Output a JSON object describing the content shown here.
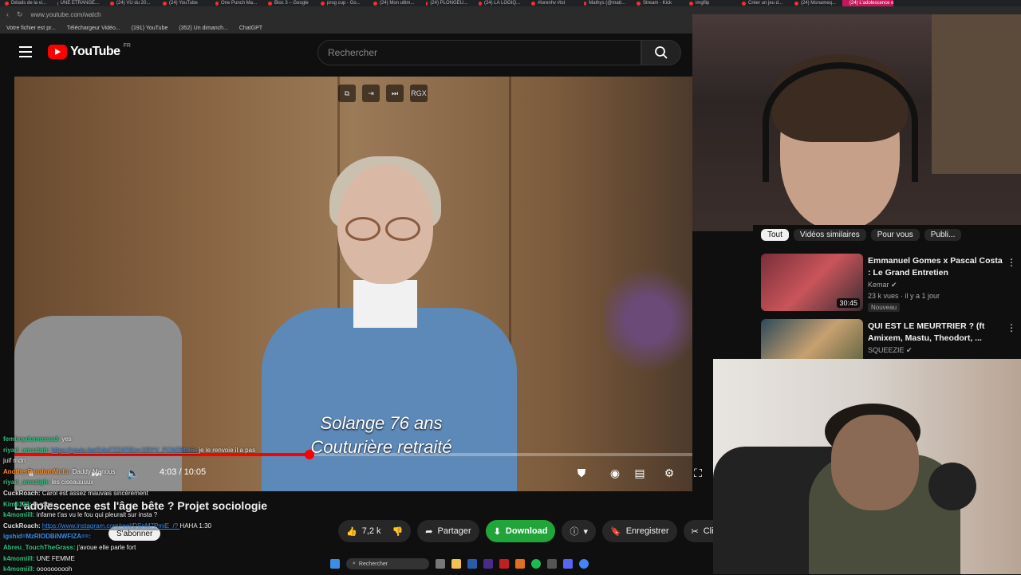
{
  "browser": {
    "tabs": [
      "Détails de la vi...",
      "UNE ETRANGE...",
      "(24) VU du 20...",
      "(24) YouTube",
      "One Punch Ma...",
      "Bloc 3 – Google",
      "prog cup - Go...",
      "(24) Mon ultim...",
      "(24) PLONGEU...",
      "(24) LA LOGIQ...",
      "#lorenhv #tst",
      "Mathys (@matt...",
      "Stream - Kick",
      "imgflip",
      "Créer un jeu d...",
      "(24) Monameq...",
      "(24) L'adolescence e..."
    ],
    "url": "www.youtube.com/watch",
    "bookmarks": [
      "Votre fichier est pr...",
      "Téléchargeur Vidéo...",
      "(191) YouTube",
      "(352) Un dimanch...",
      "ChatGPT"
    ]
  },
  "header": {
    "logo_text": "YouTube",
    "region": "FR",
    "search_placeholder": "Rechercher"
  },
  "video": {
    "overlay_badge": "RGX",
    "subtitle_line1": "Solange 76 ans",
    "subtitle_line2": "Couturière retraité",
    "time": "4:03 / 10:05",
    "progress_fraction": 0.435,
    "title": "L'adolescence est l'âge bête ? Projet sociologie"
  },
  "actions": {
    "likes": "7,2 k",
    "share": "Partager",
    "download": "Download",
    "save": "Enregistrer",
    "clip": "Clip",
    "subscribe": "S'abonner"
  },
  "chat": [
    {
      "user": "femboydumossad",
      "color": "#2ec27e",
      "text": "yes"
    },
    {
      "user": "riyad_amazigh",
      "color": "#2ec27e",
      "link": "https://youtu.be/G4xl7ZZ4TiEn=1f3YV_FCNZBtoi6s",
      "text": "je le renvoie il a pas"
    },
    {
      "user": "",
      "color": "#ffffff",
      "text": "juif mdrr"
    },
    {
      "user": "AnotherRandomMofo:",
      "color": "#ff8c1a",
      "text": "Daddy Manous"
    },
    {
      "user": "riyad_amazigh",
      "color": "#2ec27e",
      "text": "les ciseauuuux"
    },
    {
      "user": "CuckRoach",
      "color": "#dddddd",
      "text": "Carol est assez mauvais sincèrement"
    },
    {
      "user": "Kimji123",
      "color": "#2ec27e",
      "text": "la robe"
    },
    {
      "user": "k4momiill",
      "color": "#2ec27e",
      "text": "infame t'as vu le fou qui pleurait sur insta ?"
    },
    {
      "user": "CuckRoach",
      "color": "#dddddd",
      "link": "https://www.instagram.com/reel/DSnM7PmiE_/?",
      "text": "HAHA 1:30"
    },
    {
      "user": "igshid=MzRIODBiNWFlZA==",
      "color": "#3b8ef0",
      "text": ""
    },
    {
      "user": "Abreu_TouchTheGrass",
      "color": "#2ec27e",
      "text": "j'avoue elle parle fort"
    },
    {
      "user": "k4momiill",
      "color": "#2ec27e",
      "text": "UNE FEMME"
    },
    {
      "user": "k4momiill",
      "color": "#2ec27e",
      "text": "oooooooooh"
    }
  ],
  "sidebar": {
    "chips": [
      "Tout",
      "Vidéos similaires",
      "Pour vous",
      "Publi..."
    ],
    "items": [
      {
        "title": "Emmanuel Gomes x Pascal Costa : Le Grand Entretien",
        "channel": "Kemar",
        "meta": "23 k vues · il y a 1 jour",
        "badge": "Nouveau",
        "duration": "30:45"
      },
      {
        "title": "QUI EST LE MEURTRIER ? (ft Amixem, Mastu, Theodort, ...",
        "channel": "SQUEEZIE",
        "meta": "",
        "badge": "",
        "duration": ""
      }
    ]
  },
  "taskbar": {
    "search": "Rechercher"
  },
  "colors": {
    "brand_red": "#ff0000",
    "download_green": "#21a439",
    "background": "#0f0f0f"
  }
}
